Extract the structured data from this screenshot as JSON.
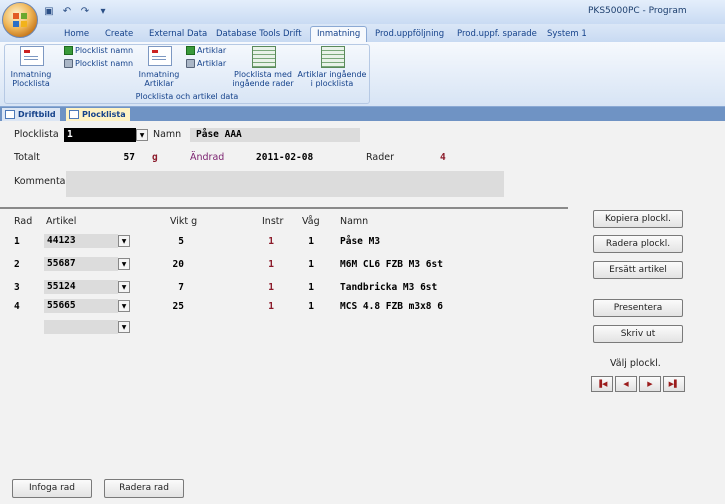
{
  "title_bar": {
    "app_title": "PKS5000PC - Program"
  },
  "ribbon_tabs": [
    "Home",
    "Create",
    "External Data",
    "Database Tools",
    "Drift",
    "Inmatning",
    "Prod.uppföljning",
    "Prod.uppf. sparade",
    "System 1"
  ],
  "ribbon": {
    "group_label": "Plocklista och artikel data",
    "inmatning_plocklista": "Inmatning Plocklista",
    "plocklist_namn_1": "Plocklist namn",
    "plocklist_namn_2": "Plocklist namn",
    "inmatning_artiklar": "Inmatning Artiklar",
    "artiklar_1": "Artiklar",
    "artiklar_2": "Artiklar",
    "plocklista_med": "Plocklista med ingående rader",
    "artiklar_ingaende": "Artiklar ingående i plocklista"
  },
  "doc_tabs": [
    "Driftbild",
    "Plocklista"
  ],
  "form": {
    "plocklista_label": "Plocklista",
    "plocklista_value": "1",
    "namn_label": "Namn",
    "namn_value": "Påse AAA",
    "totalt_label": "Totalt",
    "totalt_value": "57",
    "totalt_unit": "g",
    "andrad_label": "Ändrad",
    "andrad_value": "2011-02-08",
    "rader_label": "Rader",
    "rader_value": "4",
    "kommentar_label": "Kommentar",
    "kommentar_value": ""
  },
  "table": {
    "headers": {
      "rad": "Rad",
      "artikel": "Artikel",
      "vikt": "Vikt g",
      "instr": "Instr",
      "vag": "Våg",
      "namn": "Namn"
    },
    "rows": [
      {
        "rad": "1",
        "artikel": "44123",
        "vikt": "5",
        "instr": "1",
        "vag": "1",
        "namn": "Påse M3"
      },
      {
        "rad": "2",
        "artikel": "55687",
        "vikt": "20",
        "instr": "1",
        "vag": "1",
        "namn": "M6M CL6 FZB M3 6st"
      },
      {
        "rad": "3",
        "artikel": "55124",
        "vikt": "7",
        "instr": "1",
        "vag": "1",
        "namn": "Tandbricka M3 6st"
      },
      {
        "rad": "4",
        "artikel": "55665",
        "vikt": "25",
        "instr": "1",
        "vag": "1",
        "namn": "MCS 4.8 FZB m3x8 6"
      }
    ]
  },
  "side_buttons": {
    "kopiera": "Kopiera plockl.",
    "radera": "Radera plockl.",
    "ersatt": "Ersätt artikel",
    "presentera": "Presentera",
    "skriv_ut": "Skriv ut",
    "valj_label": "Välj plockl."
  },
  "nav_icons": [
    "first-record-icon",
    "prev-record-icon",
    "next-record-icon",
    "last-record-icon"
  ],
  "bottom_buttons": {
    "infoga": "Infoga rad",
    "radera_rad": "Radera rad"
  }
}
